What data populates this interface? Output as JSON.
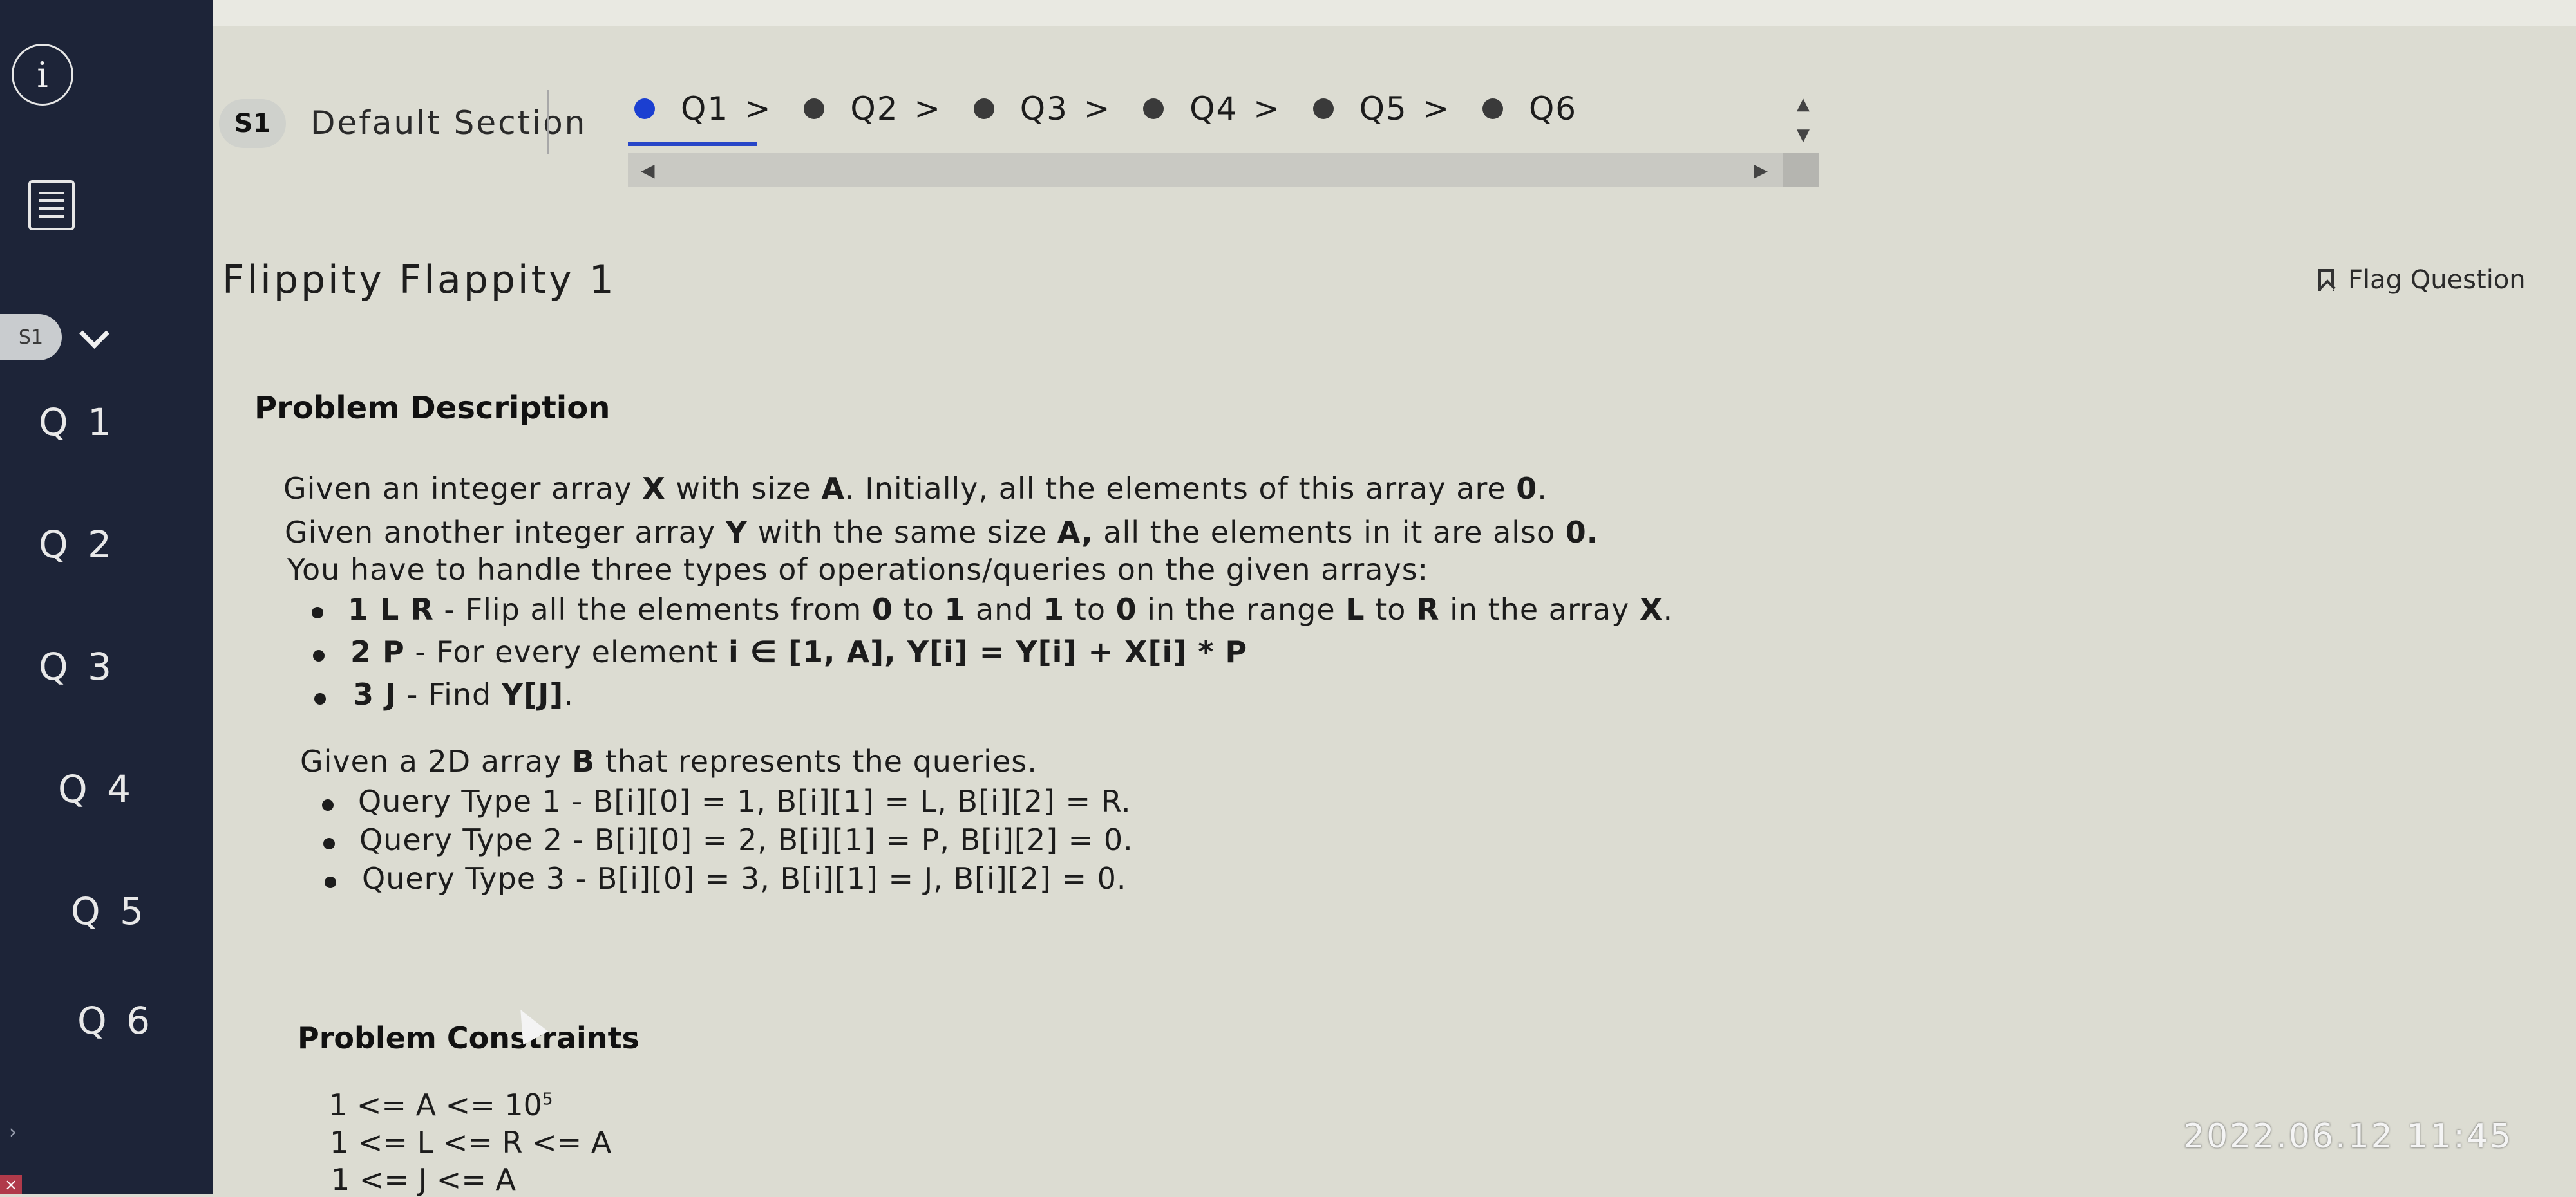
{
  "sidebar": {
    "section_chip": "S1",
    "questions": [
      "Q 1",
      "Q 2",
      "Q 3",
      "Q 4",
      "Q 5",
      "Q 6"
    ]
  },
  "nav": {
    "section_badge": "S1",
    "section_name": "Default Section",
    "tabs": [
      "Q1",
      "Q2",
      "Q3",
      "Q4",
      "Q5",
      "Q6"
    ],
    "active_tab": "Q1"
  },
  "question": {
    "title": "Flippity Flappity 1",
    "flag_label": "Flag Question"
  },
  "description": {
    "heading": "Problem Description",
    "line1": {
      "a": "Given an integer array ",
      "b": "X",
      "c": " with size ",
      "d": "A",
      "e": ". Initially, all the elements of this array are ",
      "f": "0",
      "g": "."
    },
    "line2": {
      "a": "Given another integer array ",
      "b": "Y",
      "c": " with the same size ",
      "d": "A,",
      "e": " all the elements in it are also ",
      "f": "0."
    },
    "line3": "You have to handle three types of operations/queries on the given arrays:",
    "ops": [
      {
        "a": "1 L R",
        "b": " - Flip all the elements from ",
        "c": "0",
        "d": " to ",
        "e": "1",
        "f": " and ",
        "g": "1",
        "h": " to ",
        "i": "0",
        "j": " in the range ",
        "k": "L",
        "l": " to ",
        "m": "R",
        "n": " in the array ",
        "o": "X",
        "p": "."
      },
      {
        "a": "2 P",
        "b": " - For every element ",
        "c": "i ∈ [1, A], Y[i] = Y[i] + X[i] * P"
      },
      {
        "a": "3 J",
        "b": " - Find ",
        "c": "Y[J]",
        "d": "."
      }
    ],
    "queries_intro": {
      "a": "Given a 2D array ",
      "b": "B",
      "c": " that represents the queries."
    },
    "queries": [
      "Query Type 1 - B[i][0] = 1, B[i][1] = L, B[i][2] = R.",
      "Query Type 2 - B[i][0] = 2, B[i][1] = P, B[i][2] = 0.",
      "Query Type 3 - B[i][0] = 3, B[i][1] = J, B[i][2] = 0."
    ]
  },
  "constraints": {
    "heading": "Problem Constraints",
    "c1_base": "1 <= A <= 10",
    "c1_exp": "5",
    "c2": "1 <= L <= R <= A",
    "c3": "1 <= J <= A"
  },
  "photo_timestamp": "2022.06.12 11:45"
}
